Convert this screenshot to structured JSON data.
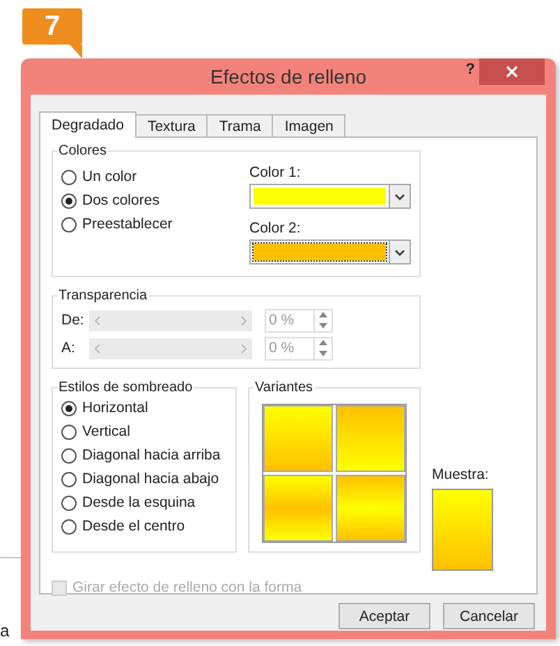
{
  "badge": "7",
  "window": {
    "title": "Efectos de relleno",
    "help": "?"
  },
  "tabs": [
    {
      "label": "Degradado",
      "selected": true
    },
    {
      "label": "Textura",
      "selected": false
    },
    {
      "label": "Trama",
      "selected": false
    },
    {
      "label": "Imagen",
      "selected": false
    }
  ],
  "colors": {
    "title": "Colores",
    "options": [
      {
        "label": "Un color",
        "selected": false
      },
      {
        "label": "Dos colores",
        "selected": true
      },
      {
        "label": "Preestablecer",
        "selected": false
      }
    ],
    "pickers": [
      {
        "label": "Color 1:",
        "color": "#ffff00",
        "focused": false
      },
      {
        "label": "Color 2:",
        "color": "#ffc000",
        "focused": true
      }
    ]
  },
  "transparency": {
    "title": "Transparencia",
    "rows": [
      {
        "label": "De:",
        "value": "0 %",
        "disabled": true
      },
      {
        "label": "A:",
        "value": "0 %",
        "disabled": true
      }
    ]
  },
  "shading": {
    "title": "Estilos de sombreado",
    "options": [
      {
        "label": "Horizontal",
        "selected": true
      },
      {
        "label": "Vertical",
        "selected": false
      },
      {
        "label": "Diagonal hacia arriba",
        "selected": false
      },
      {
        "label": "Diagonal hacia abajo",
        "selected": false
      },
      {
        "label": "Desde la esquina",
        "selected": false
      },
      {
        "label": "Desde el centro",
        "selected": false
      }
    ]
  },
  "variants": {
    "title": "Variantes",
    "items": [
      {
        "kind": "down"
      },
      {
        "kind": "up"
      },
      {
        "kind": "mid"
      },
      {
        "kind": "edge"
      }
    ]
  },
  "sample": {
    "label": "Muestra:"
  },
  "rotate_checkbox": {
    "label": "Girar efecto de relleno con la forma",
    "checked": false,
    "disabled": true
  },
  "buttons": [
    "Aceptar",
    "Cancelar"
  ],
  "background_text": "a"
}
